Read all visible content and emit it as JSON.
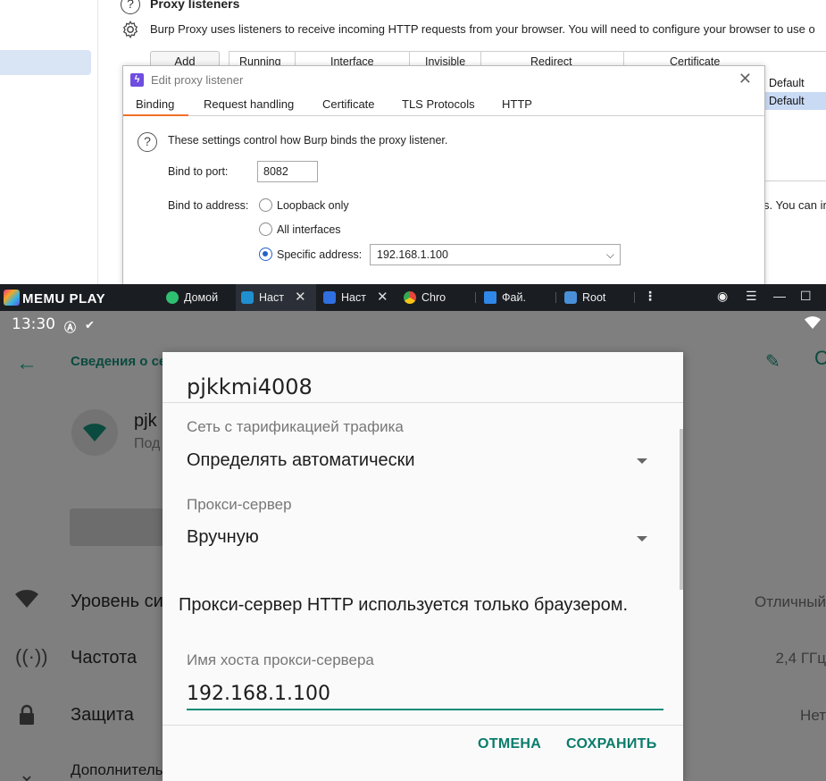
{
  "burp": {
    "section_title": "Proxy listeners",
    "description": "Burp Proxy uses listeners to receive incoming HTTP requests from your browser. You will need to configure your browser to use o",
    "add_label": "Add",
    "table_headers": [
      "Running",
      "Interface",
      "Invisible",
      "Redirect",
      "Certificate"
    ],
    "table_rows": [
      "Default",
      "Default"
    ],
    "side_text": "s. You can in",
    "dialog": {
      "title": "Edit proxy listener",
      "close_glyph": "✕",
      "tabs": [
        "Binding",
        "Request handling",
        "Certificate",
        "TLS Protocols",
        "HTTP"
      ],
      "info": "These settings control how Burp binds the proxy listener.",
      "port_label": "Bind to port:",
      "port_value": "8082",
      "address_label": "Bind to address:",
      "options": [
        "Loopback only",
        "All interfaces",
        "Specific address:"
      ],
      "selected_option": "Specific address:",
      "specific_address": "192.168.1.100"
    }
  },
  "memu": {
    "logo": "MEMU PLAY",
    "tabs": [
      {
        "label": "Домой",
        "icon": "home-icon",
        "color": "#2fbf71"
      },
      {
        "label": "Наст",
        "icon": "settings-icon",
        "color": "#1f8fcf"
      },
      {
        "label": "Наст",
        "icon": "settings-icon",
        "color": "#2f6fe0"
      },
      {
        "label": "Chro",
        "icon": "chrome-icon",
        "color": "#e8453c"
      },
      {
        "label": "Фай.",
        "icon": "folder-icon",
        "color": "#2f87e8"
      },
      {
        "label": "Root",
        "icon": "root-icon",
        "color": "#4a90d9"
      }
    ],
    "controls": [
      "⋮",
      "☰",
      "—",
      "☐",
      "✕"
    ]
  },
  "android": {
    "time": "13:30",
    "appbar_title": "Сведения о се",
    "network_name": "pjk",
    "network_sub": "Под",
    "rows": [
      {
        "icon": "wifi-signal-icon",
        "label": "Уровень си",
        "value": "Отличный"
      },
      {
        "icon": "frequency-icon",
        "label": "Частота",
        "value": "2,4 ГГц"
      },
      {
        "icon": "lock-icon",
        "label": "Защита",
        "value": "Нет"
      },
      {
        "icon": "chevron-down-icon",
        "label": "Дополнительно",
        "value": ""
      }
    ],
    "dialog": {
      "title": "pjkkmi4008",
      "metered_label": "Сеть с тарификацией трафика",
      "metered_value": "Определять автоматически",
      "proxy_label": "Прокси-сервер",
      "proxy_value": "Вручную",
      "info": "Прокси-сервер HTTP используется только браузером.",
      "host_label": "Имя хоста прокси-сервера",
      "host_value": "192.168.1.100",
      "cancel": "ОТМЕНА",
      "save": "СОХРАНИТЬ"
    }
  }
}
